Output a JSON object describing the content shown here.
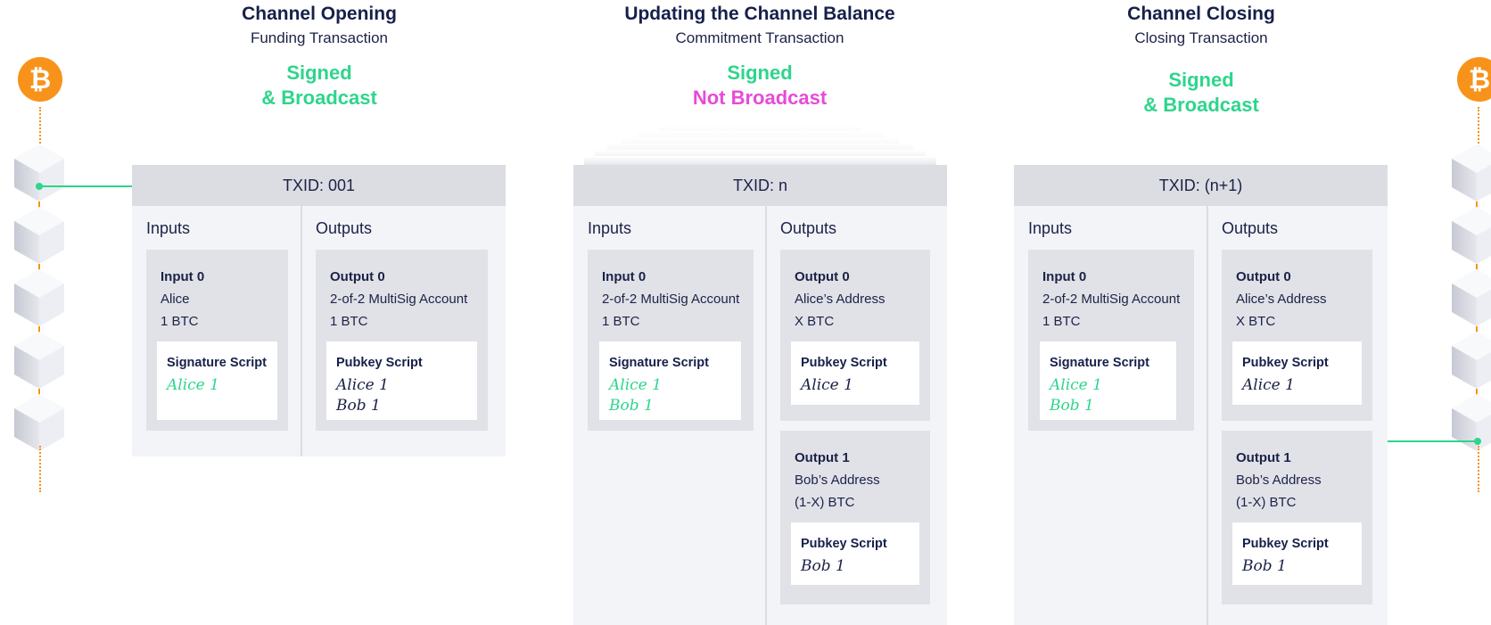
{
  "stages": [
    {
      "title": "Channel Opening",
      "subtitle": "Funding Transaction",
      "status_line1": "Signed",
      "status_line2": "& Broadcast",
      "txid": "TXID: 001",
      "inputs_label": "Inputs",
      "outputs_label": "Outputs",
      "inputs": [
        {
          "name": "Input 0",
          "line1": "Alice",
          "line2": "1 BTC",
          "script_title": "Signature Script",
          "sigs": [
            "Alice 1"
          ]
        }
      ],
      "outputs": [
        {
          "name": "Output 0",
          "line1": "2-of-2 MultiSig Account",
          "line2": "1 BTC",
          "script_title": "Pubkey Script",
          "sigs": [
            "Alice 1",
            "Bob 1"
          ]
        }
      ]
    },
    {
      "title": "Updating the Channel Balance",
      "subtitle": "Commitment Transaction",
      "status_line1": "Signed",
      "status_line2": "Not Broadcast",
      "txid": "TXID: n",
      "inputs_label": "Inputs",
      "outputs_label": "Outputs",
      "inputs": [
        {
          "name": "Input 0",
          "line1": "2-of-2 MultiSig Account",
          "line2": "1 BTC",
          "script_title": "Signature Script",
          "sigs": [
            "Alice 1",
            "Bob 1"
          ]
        }
      ],
      "outputs": [
        {
          "name": "Output 0",
          "line1": "Alice’s Address",
          "line2": "X BTC",
          "script_title": "Pubkey Script",
          "sigs": [
            "Alice 1"
          ]
        },
        {
          "name": "Output 1",
          "line1": "Bob’s Address",
          "line2": "(1-X) BTC",
          "script_title": "Pubkey Script",
          "sigs": [
            "Bob 1"
          ]
        }
      ]
    },
    {
      "title": "Channel Closing",
      "subtitle": "Closing Transaction",
      "status_line1": "Signed",
      "status_line2": "& Broadcast",
      "txid": "TXID: (n+1)",
      "inputs_label": "Inputs",
      "outputs_label": "Outputs",
      "inputs": [
        {
          "name": "Input 0",
          "line1": "2-of-2 MultiSig Account",
          "line2": "1 BTC",
          "script_title": "Signature Script",
          "sigs": [
            "Alice 1",
            "Bob 1"
          ]
        }
      ],
      "outputs": [
        {
          "name": "Output 0",
          "line1": "Alice’s Address",
          "line2": "X BTC",
          "script_title": "Pubkey Script",
          "sigs": [
            "Alice 1"
          ]
        },
        {
          "name": "Output 1",
          "line1": "Bob’s Address",
          "line2": "(1-X) BTC",
          "script_title": "Pubkey Script",
          "sigs": [
            "Bob 1"
          ]
        }
      ]
    }
  ],
  "colors": {
    "bitcoin_orange": "#f7931a",
    "broadcast_green": "#2ed58c",
    "not_broadcast_pink": "#e84ad8",
    "title_navy": "#16204a"
  },
  "icons": [
    "bitcoin-icon",
    "blockchain-block-icon"
  ]
}
